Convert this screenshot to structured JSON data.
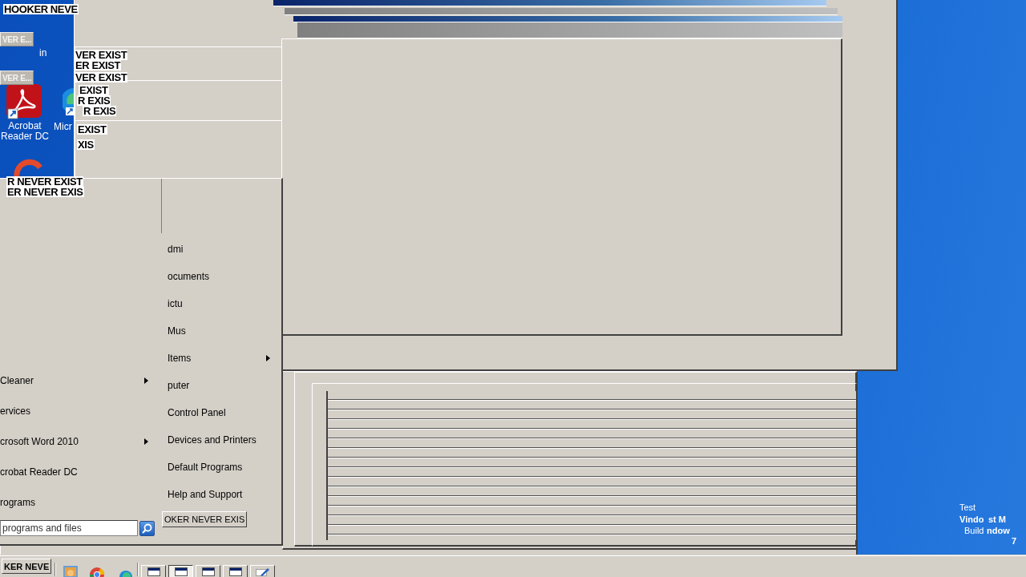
{
  "desktop_icons": [
    {
      "kind": "recycle",
      "label": "in"
    },
    {
      "kind": "acrobat",
      "label": "Acrobat Reader DC"
    },
    {
      "kind": "edge",
      "label": "Micr"
    },
    {
      "kind": "ccleaner"
    }
  ],
  "title_bars": [
    {
      "active": true
    },
    {
      "active": false
    },
    {
      "active": true
    },
    {
      "active": false
    }
  ],
  "title_fragments": [
    {
      "kind": "label",
      "text": "HOOKER NEVE"
    },
    {
      "kind": "button",
      "text": "VER E..."
    },
    {
      "kind": "label",
      "text": "VER EXIST"
    },
    {
      "kind": "label",
      "text": "ER EXIST"
    },
    {
      "kind": "button",
      "text": "VER E..."
    },
    {
      "kind": "label",
      "text": "VER EXIST"
    },
    {
      "kind": "label",
      "text": "EXIST"
    },
    {
      "kind": "label",
      "text": "R EXIS"
    },
    {
      "kind": "label",
      "text": "R EXIS"
    },
    {
      "kind": "label",
      "text": "EXIST"
    },
    {
      "kind": "label",
      "text": "XIS"
    },
    {
      "kind": "label",
      "text": "R NEVER EXIST"
    },
    {
      "kind": "label",
      "text": "ER NEVER EXIS"
    }
  ],
  "start_menu": {
    "programs": [
      {
        "label": "Cleaner",
        "submenu": true
      },
      {
        "label": "ervices",
        "submenu": false
      },
      {
        "label": "crosoft Word 2010",
        "submenu": true
      },
      {
        "label": "crobat Reader DC",
        "submenu": false
      },
      {
        "label": "rograms",
        "submenu": false
      }
    ],
    "search": {
      "placeholder": "programs and files"
    },
    "places": [
      {
        "label": "dmi",
        "submenu": false
      },
      {
        "label": "ocuments",
        "submenu": false
      },
      {
        "label": "ictu",
        "submenu": false
      },
      {
        "label": "Mus",
        "submenu": false
      },
      {
        "label": "Items",
        "submenu": true
      },
      {
        "label": "puter",
        "submenu": false
      },
      {
        "label": "Control Panel",
        "submenu": false
      },
      {
        "label": "Devices and Printers",
        "submenu": false
      },
      {
        "label": "Default Programs",
        "submenu": false
      },
      {
        "label": "Help and Support",
        "submenu": false
      }
    ],
    "shutdown_button": "OKER NEVER EXIS"
  },
  "desktop_text": [
    "Test",
    "Vindo",
    "st M",
    "Build",
    "ndow",
    "7"
  ],
  "taskbar": {
    "start_button": "KER NEVE",
    "quick_launch": [
      {
        "kind": "photo"
      },
      {
        "kind": "browser"
      },
      {
        "kind": "swirl"
      }
    ],
    "tasks": [
      {
        "kind": "window",
        "selected": false
      },
      {
        "kind": "window",
        "selected": true
      },
      {
        "kind": "window",
        "selected": false
      },
      {
        "kind": "window",
        "selected": false
      },
      {
        "kind": "notepad",
        "selected": false
      }
    ]
  }
}
